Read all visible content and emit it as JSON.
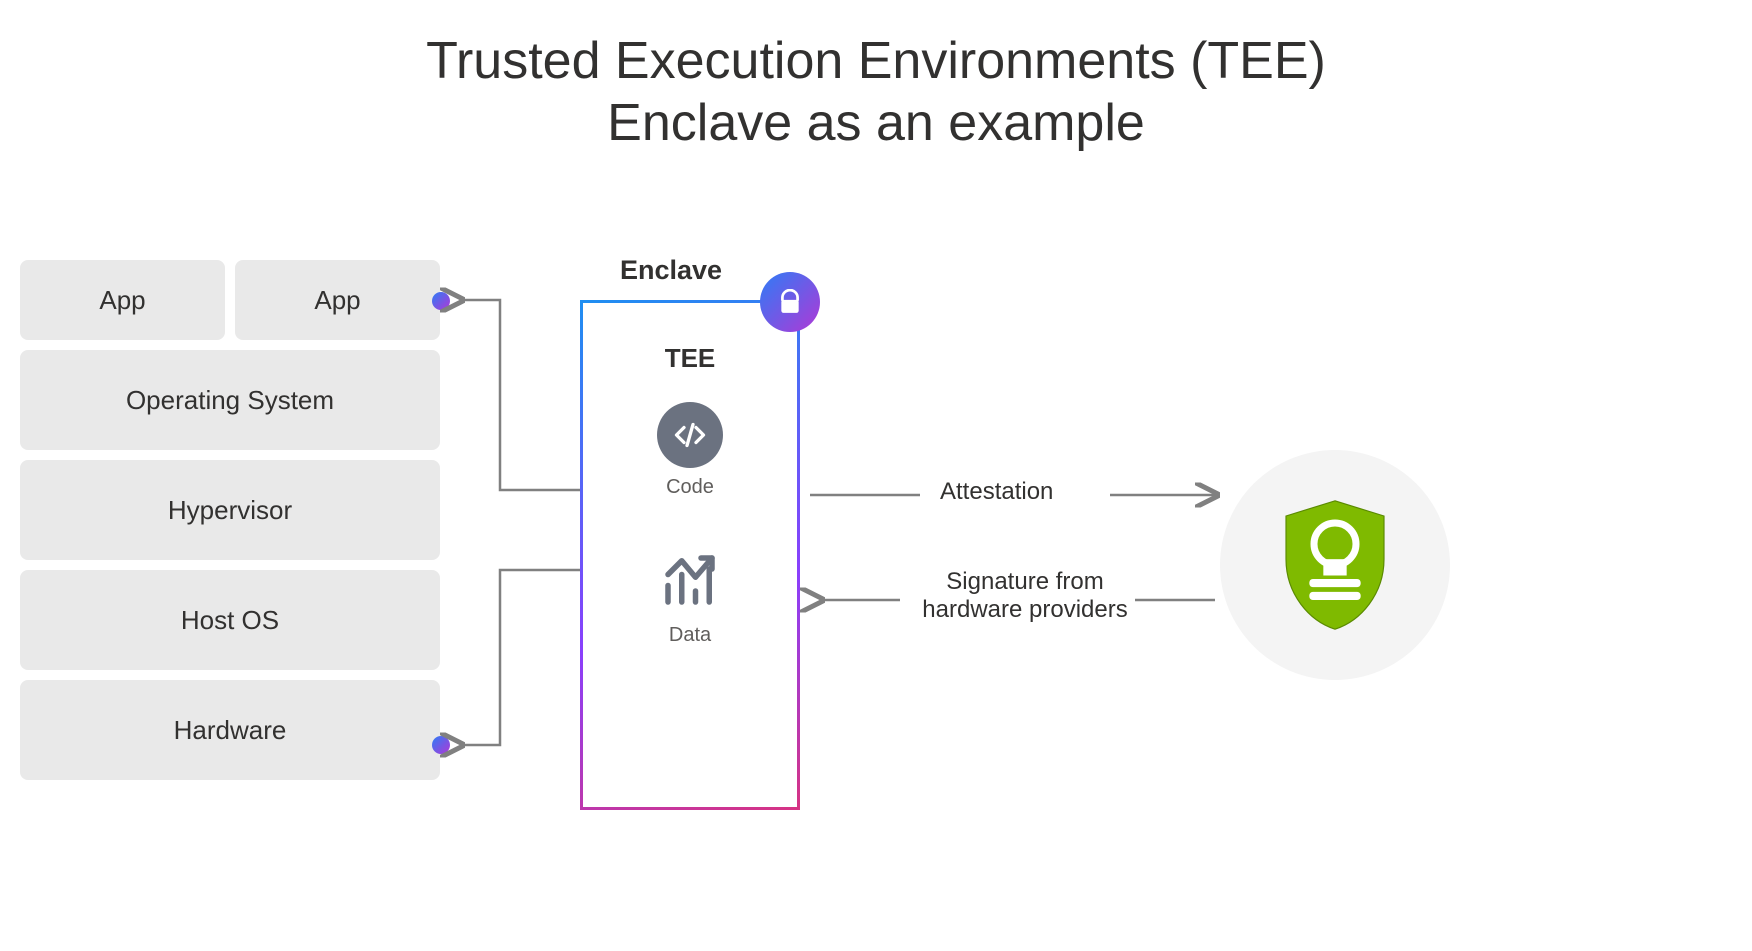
{
  "title_line1": "Trusted Execution Environments (TEE)",
  "title_line2": "Enclave as an example",
  "stack": {
    "app1": "App",
    "app2": "App",
    "os": "Operating System",
    "hypervisor": "Hypervisor",
    "host_os": "Host OS",
    "hardware": "Hardware"
  },
  "enclave": {
    "label": "Enclave",
    "tee": "TEE",
    "code": "Code",
    "data": "Data"
  },
  "arrows": {
    "attestation": "Attestation",
    "signature_line1": "Signature from",
    "signature_line2": "hardware providers"
  },
  "icons": {
    "lock": "lock-icon",
    "code": "code-icon",
    "chart": "chart-icon",
    "shield_stamp": "shield-stamp-icon"
  },
  "colors": {
    "box_bg": "#e9e9e9",
    "gradient_start": "#2e7cf6",
    "gradient_end": "#b038d6",
    "shield_green": "#7fba00",
    "connector": "#808080",
    "icon_gray": "#6b7280"
  }
}
